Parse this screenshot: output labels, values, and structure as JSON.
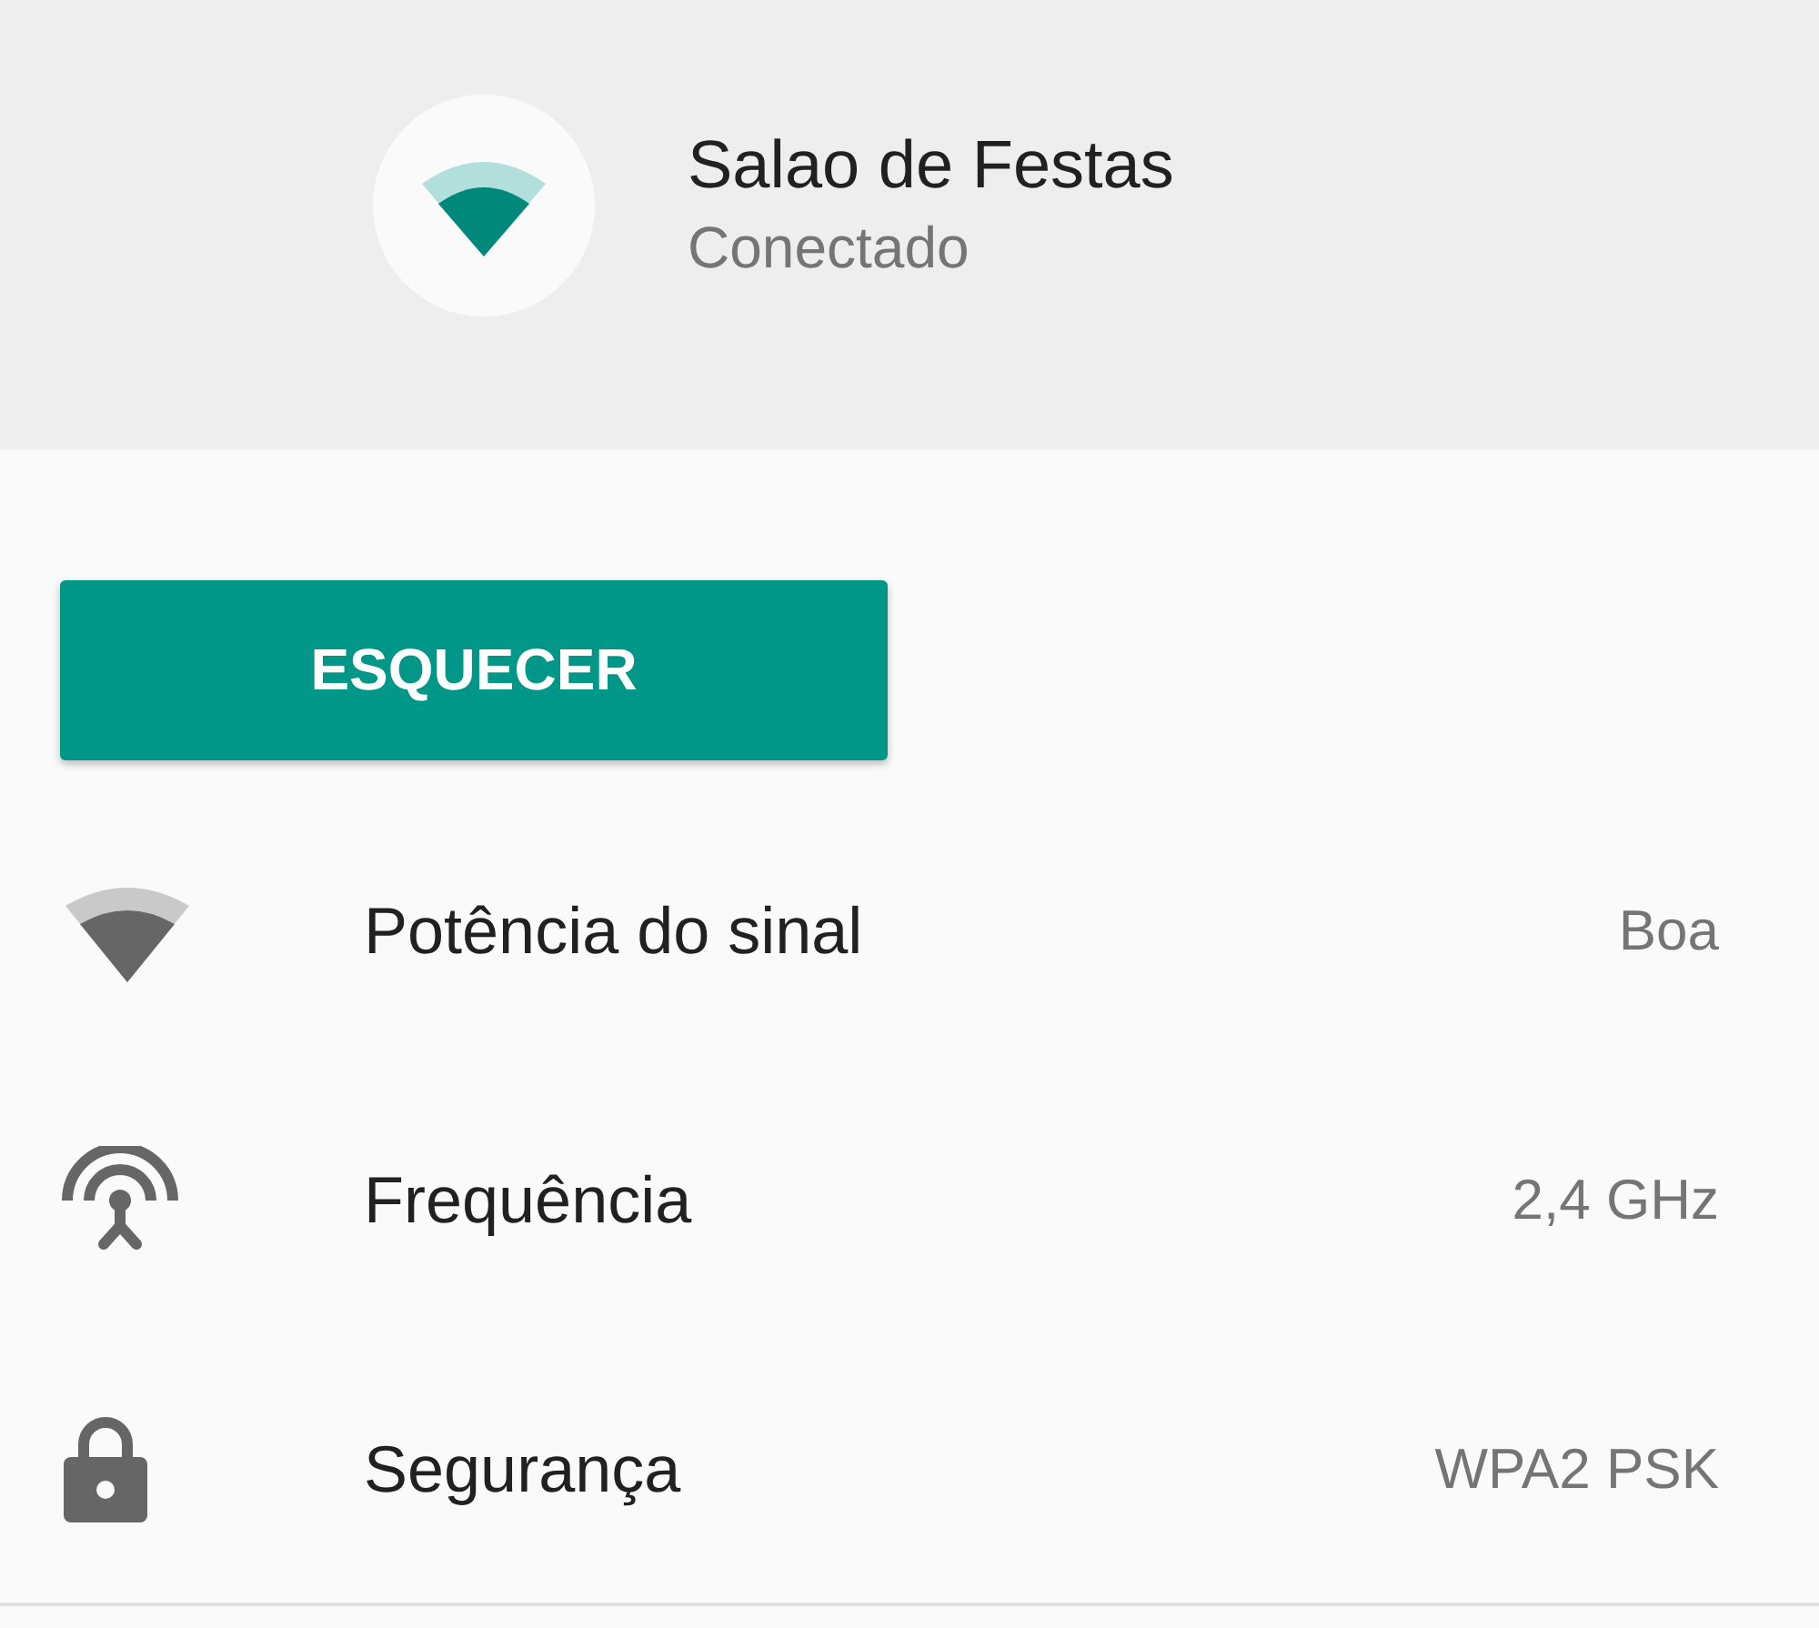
{
  "network": {
    "name": "Salao de Festas",
    "status": "Conectado"
  },
  "forget_button": {
    "label": "ESQUECER"
  },
  "details": [
    {
      "kind": "signal",
      "label": "Potência do sinal",
      "value": "Boa"
    },
    {
      "kind": "antenna",
      "label": "Frequência",
      "value": "2,4 GHz"
    },
    {
      "kind": "lock",
      "label": "Segurança",
      "value": "WPA2 PSK"
    }
  ]
}
